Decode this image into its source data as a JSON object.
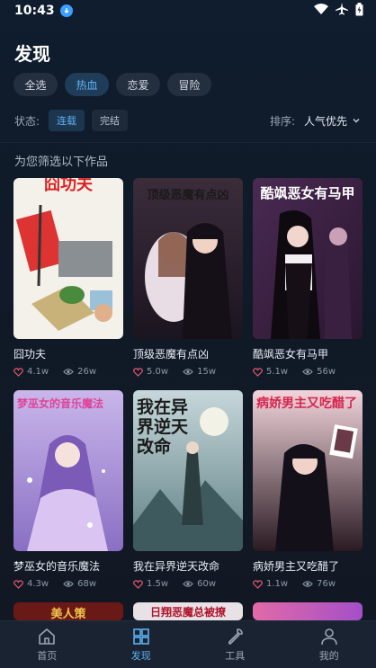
{
  "status": {
    "time": "10:43"
  },
  "page": {
    "title": "发现"
  },
  "genre_chips": [
    {
      "label": "全选",
      "active": false
    },
    {
      "label": "热血",
      "active": true
    },
    {
      "label": "恋爱",
      "active": false
    },
    {
      "label": "冒险",
      "active": false
    }
  ],
  "filters": {
    "status_label": "状态:",
    "status_options": [
      {
        "label": "连载",
        "active": true
      },
      {
        "label": "完结",
        "active": false
      }
    ],
    "sort_label": "排序:",
    "sort_value": "人气优先"
  },
  "section_label": "为您筛选以下作品",
  "comics": [
    {
      "title": "囧功夫",
      "likes": "4.1w",
      "views": "26w",
      "cover_text": "囧功夫"
    },
    {
      "title": "顶级恶魔有点凶",
      "likes": "5.0w",
      "views": "15w",
      "cover_text": "顶级恶魔有点凶"
    },
    {
      "title": "酷飒恶女有马甲",
      "likes": "5.1w",
      "views": "56w",
      "cover_text": "酷飒恶女有马甲"
    },
    {
      "title": "梦巫女的音乐魔法",
      "likes": "4.3w",
      "views": "68w",
      "cover_text": "梦巫女的音乐魔法"
    },
    {
      "title": "我在异界逆天改命",
      "likes": "1.5w",
      "views": "60w",
      "cover_text": "我在异界逆天改命"
    },
    {
      "title": "病娇男主又吃醋了",
      "likes": "1.1w",
      "views": "76w",
      "cover_text": "病娇男主又吃醋了"
    }
  ],
  "partial_covers": [
    {
      "cover_text": "美人策"
    },
    {
      "cover_text": "日翔恶魔总被撩"
    },
    {
      "cover_text": ""
    }
  ],
  "bottom_nav": [
    {
      "label": "首页",
      "icon": "home-icon",
      "active": false
    },
    {
      "label": "发现",
      "icon": "grid-icon",
      "active": true
    },
    {
      "label": "工具",
      "icon": "wrench-icon",
      "active": false
    },
    {
      "label": "我的",
      "icon": "user-icon",
      "active": false
    }
  ],
  "colors": {
    "accent": "#5cb2f2",
    "like": "#e2586d",
    "background": "#0f1d2e"
  }
}
